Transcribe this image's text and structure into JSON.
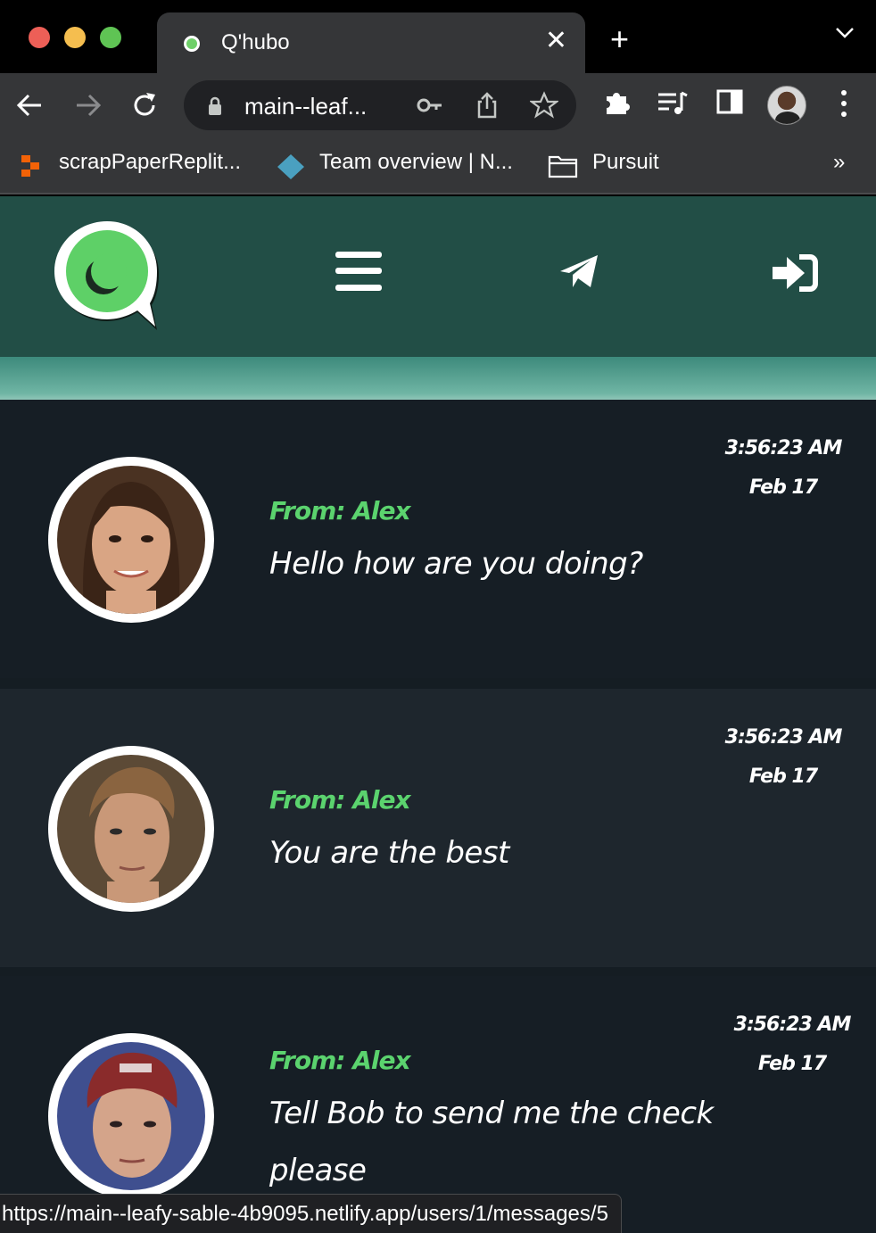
{
  "browser": {
    "tab_title": "Q'hubo",
    "url": "main--leaf...",
    "bookmarks": [
      {
        "label": "scrapPaperReplit..."
      },
      {
        "label": "Team overview | N..."
      },
      {
        "label": "Pursuit"
      }
    ],
    "bookmarks_overflow": "»",
    "status_url": "https://main--leafy-sable-4b9095.netlify.app/users/1/messages/5"
  },
  "app": {
    "colors": {
      "header": "#224e46",
      "accent": "#5bd36e",
      "card_dark": "#161e25",
      "card_alt": "#1e262d"
    },
    "header_icons": [
      "logo-icon",
      "menu-icon",
      "send-icon",
      "login-icon"
    ]
  },
  "messages": [
    {
      "from": "From: Alex",
      "text": "Hello how are you doing?",
      "time": "3:56:23 AM",
      "date": "Feb 17"
    },
    {
      "from": "From: Alex",
      "text": "You are the best",
      "time": "3:56:23 AM",
      "date": "Feb 17"
    },
    {
      "from": "From: Alex",
      "text": "Tell Bob to send me the check please",
      "time": "3:56:23 AM",
      "date": "Feb 17"
    }
  ]
}
